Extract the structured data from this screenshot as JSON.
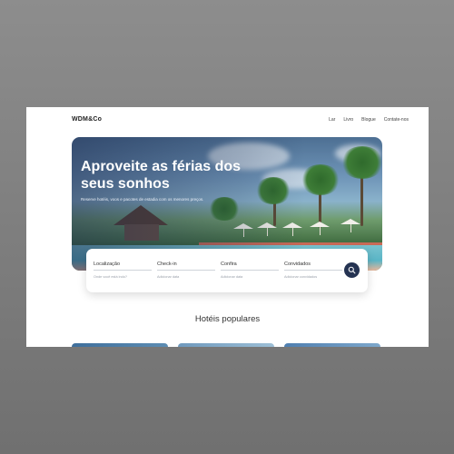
{
  "nav": {
    "brand": "WDM&Co",
    "links": [
      "Lar",
      "Livro",
      "Blogue",
      "Contate-nos"
    ]
  },
  "hero": {
    "title": "Aproveite as férias dos seus sonhos",
    "subtitle": "Reserve hotéis, voos e pacotes de estadia com os menores preços."
  },
  "search": {
    "fields": [
      {
        "label": "Localização",
        "placeholder": "Onde você está indo?"
      },
      {
        "label": "Check-in",
        "placeholder": "Adicionar data"
      },
      {
        "label": "Confira",
        "placeholder": "Adicionar data"
      },
      {
        "label": "Convidados",
        "placeholder": "Adicionar convidados"
      }
    ],
    "button_icon": "search-icon"
  },
  "popular": {
    "title": "Hotéis populares"
  },
  "colors": {
    "accent": "#253352",
    "background": "#7d7d7d",
    "page": "#ffffff"
  }
}
